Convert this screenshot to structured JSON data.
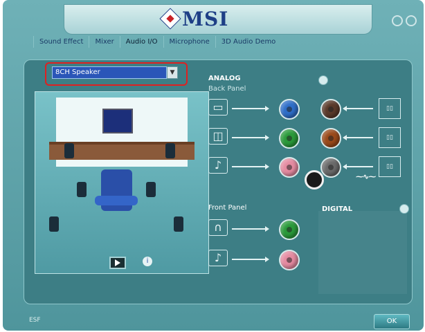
{
  "header": {
    "logo": "MSI"
  },
  "tabs": [
    "Sound Effect",
    "Mixer",
    "Audio I/O",
    "Microphone",
    "3D Audio Demo"
  ],
  "device": {
    "selected": "8CH Speaker",
    "arrow": "▼"
  },
  "analog": {
    "title": "ANALOG",
    "back_panel": "Back Panel",
    "front_panel": "Front Panel"
  },
  "digital": {
    "title": "DIGITAL"
  },
  "footer": {
    "left": "ESF",
    "ok": "OK"
  },
  "colors": {
    "accent_highlight": "#e02020",
    "jack_blue": "#2e6ec8",
    "jack_green": "#2a9a3a",
    "jack_pink": "#e48aa0",
    "jack_brown": "#5a3a2a",
    "jack_orange": "#9a4a1a",
    "jack_gray": "#6a6a6a"
  },
  "icons": [
    "microphone-icon",
    "headphones-icon",
    "line-in-icon",
    "speaker-config-icon",
    "gear-icon",
    "play-icon",
    "info-icon"
  ]
}
